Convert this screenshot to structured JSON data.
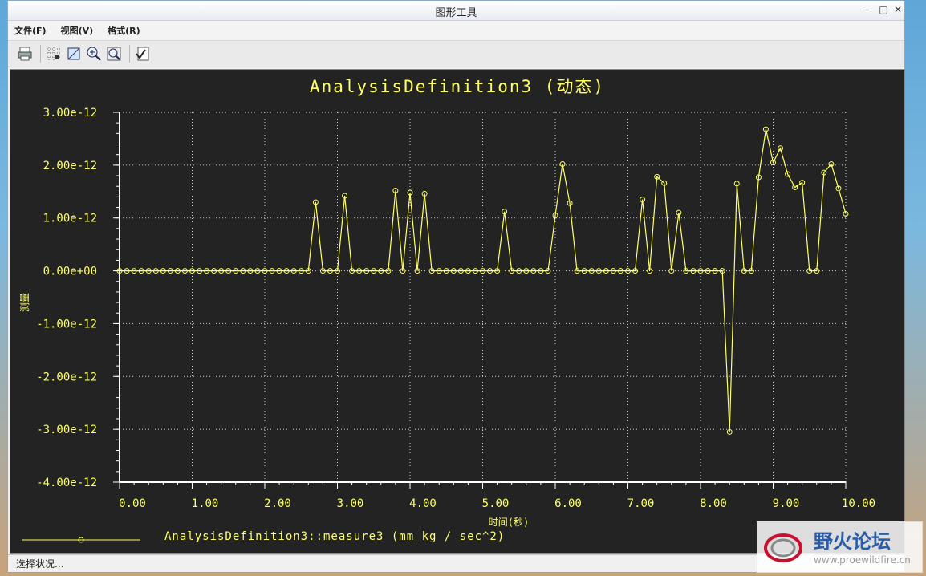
{
  "window": {
    "title": "图形工具",
    "min": "–",
    "max": "□",
    "close": "✕"
  },
  "menu": [
    "文件(F)",
    "视图(V)",
    "格式(R)"
  ],
  "toolbar": [
    "print-icon",
    "grid-icon",
    "view-icon",
    "zoom-in-icon",
    "zoom-fit-icon",
    "check-icon"
  ],
  "status": "选择状况...",
  "watermark": {
    "title": "野火论坛",
    "url": "www.proewildfire.cn"
  },
  "chart_data": {
    "type": "line",
    "title": "AnalysisDefinition3 (动态)",
    "xlabel": "时间(秒)",
    "ylabel": "测量",
    "xlim": [
      0,
      10
    ],
    "ylim": [
      -4e-12,
      3e-12
    ],
    "x_ticks": [
      "0.00",
      "1.00",
      "2.00",
      "3.00",
      "4.00",
      "5.00",
      "6.00",
      "7.00",
      "8.00",
      "9.00",
      "10.00"
    ],
    "y_ticks": [
      "3.00e-12",
      "2.00e-12",
      "1.00e-12",
      "0.00e+00",
      "-1.00e-12",
      "-2.00e-12",
      "-3.00e-12",
      "-4.00e-12"
    ],
    "grid": true,
    "legend": "bottom-left",
    "color": "#ffff66",
    "series": [
      {
        "name": "AnalysisDefinition3::measure3 (mm kg / sec^2)",
        "x": [
          0,
          0.1,
          0.2,
          0.3,
          0.4,
          0.5,
          0.6,
          0.7,
          0.8,
          0.9,
          1.0,
          1.1,
          1.2,
          1.3,
          1.4,
          1.5,
          1.6,
          1.7,
          1.8,
          1.9,
          2.0,
          2.1,
          2.2,
          2.3,
          2.4,
          2.5,
          2.6,
          2.7,
          2.8,
          2.9,
          3.0,
          3.1,
          3.2,
          3.3,
          3.4,
          3.5,
          3.6,
          3.7,
          3.8,
          3.9,
          4.0,
          4.1,
          4.2,
          4.3,
          4.4,
          4.5,
          4.6,
          4.7,
          4.8,
          4.9,
          5.0,
          5.1,
          5.2,
          5.3,
          5.4,
          5.5,
          5.6,
          5.7,
          5.8,
          5.9,
          6.0,
          6.1,
          6.2,
          6.3,
          6.4,
          6.5,
          6.6,
          6.7,
          6.8,
          6.9,
          7.0,
          7.1,
          7.2,
          7.3,
          7.4,
          7.5,
          7.6,
          7.7,
          7.8,
          7.9,
          8.0,
          8.1,
          8.2,
          8.3,
          8.4,
          8.5,
          8.6,
          8.7,
          8.8,
          8.9,
          9.0,
          9.1,
          9.2,
          9.3,
          9.4,
          9.5,
          9.6,
          9.7,
          9.8,
          9.9,
          10.0
        ],
        "y": [
          0,
          0,
          0,
          0,
          0,
          0,
          0,
          0,
          0,
          0,
          0,
          0,
          0,
          0,
          0,
          0,
          0,
          0,
          0,
          0,
          0,
          0,
          0,
          0,
          0,
          0,
          0,
          1.3e-12,
          0,
          0,
          0,
          1.42e-12,
          0,
          0,
          0,
          0,
          0,
          0,
          1.52e-12,
          0,
          1.48e-12,
          0,
          1.46e-12,
          0,
          0,
          0,
          0,
          0,
          0,
          0,
          0,
          0,
          0,
          1.12e-12,
          0,
          0,
          0,
          0,
          0,
          0,
          1.05e-12,
          2.02e-12,
          1.28e-12,
          0,
          0,
          0,
          0,
          0,
          0,
          0,
          0,
          0,
          1.35e-12,
          0,
          1.78e-12,
          1.66e-12,
          0,
          1.1e-12,
          0,
          0,
          0,
          0,
          0,
          0,
          -3.05e-12,
          1.65e-12,
          0,
          0,
          1.77e-12,
          2.68e-12,
          2.05e-12,
          2.32e-12,
          1.83e-12,
          1.58e-12,
          1.67e-12,
          0,
          0,
          1.86e-12,
          2.02e-12,
          1.56e-12,
          1.08e-12
        ]
      }
    ]
  }
}
